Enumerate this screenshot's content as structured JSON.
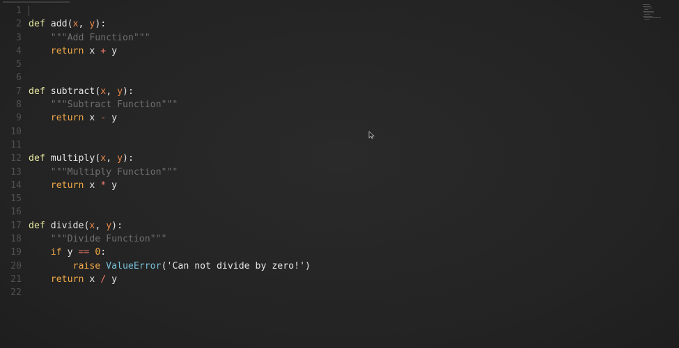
{
  "editor": {
    "lines": [
      {
        "n": "1",
        "tokens": []
      },
      {
        "n": "2",
        "tokens": [
          [
            "kwdef",
            "def "
          ],
          [
            "fn",
            "add"
          ],
          [
            "punc",
            "("
          ],
          [
            "param",
            "x"
          ],
          [
            "punc",
            ", "
          ],
          [
            "param",
            "y"
          ],
          [
            "punc",
            "):"
          ]
        ]
      },
      {
        "n": "3",
        "tokens": [
          [
            "doc",
            "    \"\"\"Add Function\"\"\""
          ]
        ]
      },
      {
        "n": "4",
        "tokens": [
          [
            "kw",
            "    return "
          ],
          [
            "fn",
            "x "
          ],
          [
            "op",
            "+"
          ],
          [
            "fn",
            " y"
          ]
        ]
      },
      {
        "n": "5",
        "tokens": []
      },
      {
        "n": "6",
        "tokens": []
      },
      {
        "n": "7",
        "tokens": [
          [
            "kwdef",
            "def "
          ],
          [
            "fn",
            "subtract"
          ],
          [
            "punc",
            "("
          ],
          [
            "param",
            "x"
          ],
          [
            "punc",
            ", "
          ],
          [
            "param",
            "y"
          ],
          [
            "punc",
            "):"
          ]
        ]
      },
      {
        "n": "8",
        "tokens": [
          [
            "doc",
            "    \"\"\"Subtract Function\"\"\""
          ]
        ]
      },
      {
        "n": "9",
        "tokens": [
          [
            "kw",
            "    return "
          ],
          [
            "fn",
            "x "
          ],
          [
            "op",
            "-"
          ],
          [
            "fn",
            " y"
          ]
        ]
      },
      {
        "n": "10",
        "tokens": []
      },
      {
        "n": "11",
        "tokens": []
      },
      {
        "n": "12",
        "tokens": [
          [
            "kwdef",
            "def "
          ],
          [
            "fn",
            "multiply"
          ],
          [
            "punc",
            "("
          ],
          [
            "param",
            "x"
          ],
          [
            "punc",
            ", "
          ],
          [
            "param",
            "y"
          ],
          [
            "punc",
            "):"
          ]
        ]
      },
      {
        "n": "13",
        "tokens": [
          [
            "doc",
            "    \"\"\"Multiply Function\"\"\""
          ]
        ]
      },
      {
        "n": "14",
        "tokens": [
          [
            "kw",
            "    return "
          ],
          [
            "fn",
            "x "
          ],
          [
            "op",
            "*"
          ],
          [
            "fn",
            " y"
          ]
        ]
      },
      {
        "n": "15",
        "tokens": []
      },
      {
        "n": "16",
        "tokens": []
      },
      {
        "n": "17",
        "tokens": [
          [
            "kwdef",
            "def "
          ],
          [
            "fn",
            "divide"
          ],
          [
            "punc",
            "("
          ],
          [
            "param",
            "x"
          ],
          [
            "punc",
            ", "
          ],
          [
            "param",
            "y"
          ],
          [
            "punc",
            "):"
          ]
        ]
      },
      {
        "n": "18",
        "tokens": [
          [
            "doc",
            "    \"\"\"Divide Function\"\"\""
          ]
        ]
      },
      {
        "n": "19",
        "tokens": [
          [
            "kw",
            "    if "
          ],
          [
            "fn",
            "y "
          ],
          [
            "op",
            "=="
          ],
          [
            "fn",
            " "
          ],
          [
            "num",
            "0"
          ],
          [
            "punc",
            ":"
          ]
        ]
      },
      {
        "n": "20",
        "tokens": [
          [
            "kw",
            "        raise "
          ],
          [
            "builtin",
            "ValueError"
          ],
          [
            "punc",
            "("
          ],
          [
            "str",
            "'Can not divide by zero!'"
          ],
          [
            "punc",
            ")"
          ]
        ]
      },
      {
        "n": "21",
        "tokens": [
          [
            "kw",
            "    return "
          ],
          [
            "fn",
            "x "
          ],
          [
            "op",
            "/"
          ],
          [
            "fn",
            " y"
          ]
        ]
      },
      {
        "n": "22",
        "tokens": []
      }
    ]
  },
  "colors": {
    "background": "#242424",
    "keyword": "#f0a848",
    "parameter": "#e8884a",
    "operator": "#f07a6a",
    "docstring": "#6f6f6f",
    "builtin": "#78c0d8",
    "line_number": "#505050"
  },
  "icons": {
    "minimap": "minimap-icon",
    "pointer": "mouse-pointer-icon"
  }
}
